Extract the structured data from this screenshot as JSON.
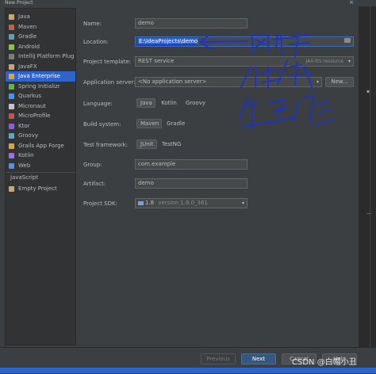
{
  "window": {
    "title": "New Project",
    "close_icon": "×"
  },
  "sidebar": {
    "items": [
      {
        "label": "Java",
        "icon": "folder-icon",
        "color": "#c9a96b"
      },
      {
        "label": "Maven",
        "icon": "maven-icon",
        "color": "#c25f4e"
      },
      {
        "label": "Gradle",
        "icon": "gradle-icon",
        "color": "#5ea0b5"
      },
      {
        "label": "Android",
        "icon": "android-icon",
        "color": "#8ac24a"
      },
      {
        "label": "IntelliJ Platform Plug",
        "icon": "plugin-icon",
        "color": "#7d7d7d"
      },
      {
        "label": "JavaFX",
        "icon": "folder-icon",
        "color": "#c9a96b"
      },
      {
        "label": "Java Enterprise",
        "icon": "javaee-icon",
        "color": "#e3a33a",
        "selected": true
      },
      {
        "label": "Spring Initializr",
        "icon": "spring-icon",
        "color": "#6cb33e"
      },
      {
        "label": "Quarkus",
        "icon": "quarkus-icon",
        "color": "#4695eb"
      },
      {
        "label": "Micronaut",
        "icon": "micronaut-icon",
        "color": "#c4c4c4"
      },
      {
        "label": "MicroProfile",
        "icon": "microprofile-icon",
        "color": "#d14f3f"
      },
      {
        "label": "Ktor",
        "icon": "ktor-icon",
        "color": "#8f5fd6"
      },
      {
        "label": "Groovy",
        "icon": "groovy-icon",
        "color": "#5fa6c7"
      },
      {
        "label": "Grails App Forge",
        "icon": "grails-icon",
        "color": "#e0a13a"
      },
      {
        "label": "Kotlin",
        "icon": "kotlin-icon",
        "color": "#9b6cf0"
      },
      {
        "label": "Web",
        "icon": "web-icon",
        "color": "#5a8fd9"
      }
    ],
    "section": "JavaScript",
    "extra_items": [
      {
        "label": "Empty Project",
        "icon": "folder-icon",
        "color": "#c9a96b"
      }
    ]
  },
  "form": {
    "name_label": "Name:",
    "name_value": "demo",
    "location_label": "Location:",
    "location_value": "E:\\IdeaProjects\\demo",
    "template_label": "Project template:",
    "template_value": "REST service",
    "template_hint": "JAX-RS resource",
    "server_label": "Application server:",
    "server_value": "<No application server>",
    "new_button": "New...",
    "language_label": "Language:",
    "language_options": [
      "Java",
      "Kotlin",
      "Groovy"
    ],
    "build_label": "Build system:",
    "build_options": [
      "Maven",
      "Gradle"
    ],
    "test_label": "Test framework:",
    "test_options": [
      "JUnit",
      "TestNG"
    ],
    "group_label": "Group:",
    "group_value": "com.example",
    "artifact_label": "Artifact:",
    "artifact_value": "demo",
    "sdk_label": "Project SDK:",
    "sdk_value": "1.8",
    "sdk_version": "version 1.8.0_361"
  },
  "footer": {
    "previous": "Previous",
    "next": "Next",
    "cancel": "Cancel",
    "help": "Help"
  },
  "watermark": "CSDN @白帽小丑",
  "annotation_color": "#1a2fd6"
}
